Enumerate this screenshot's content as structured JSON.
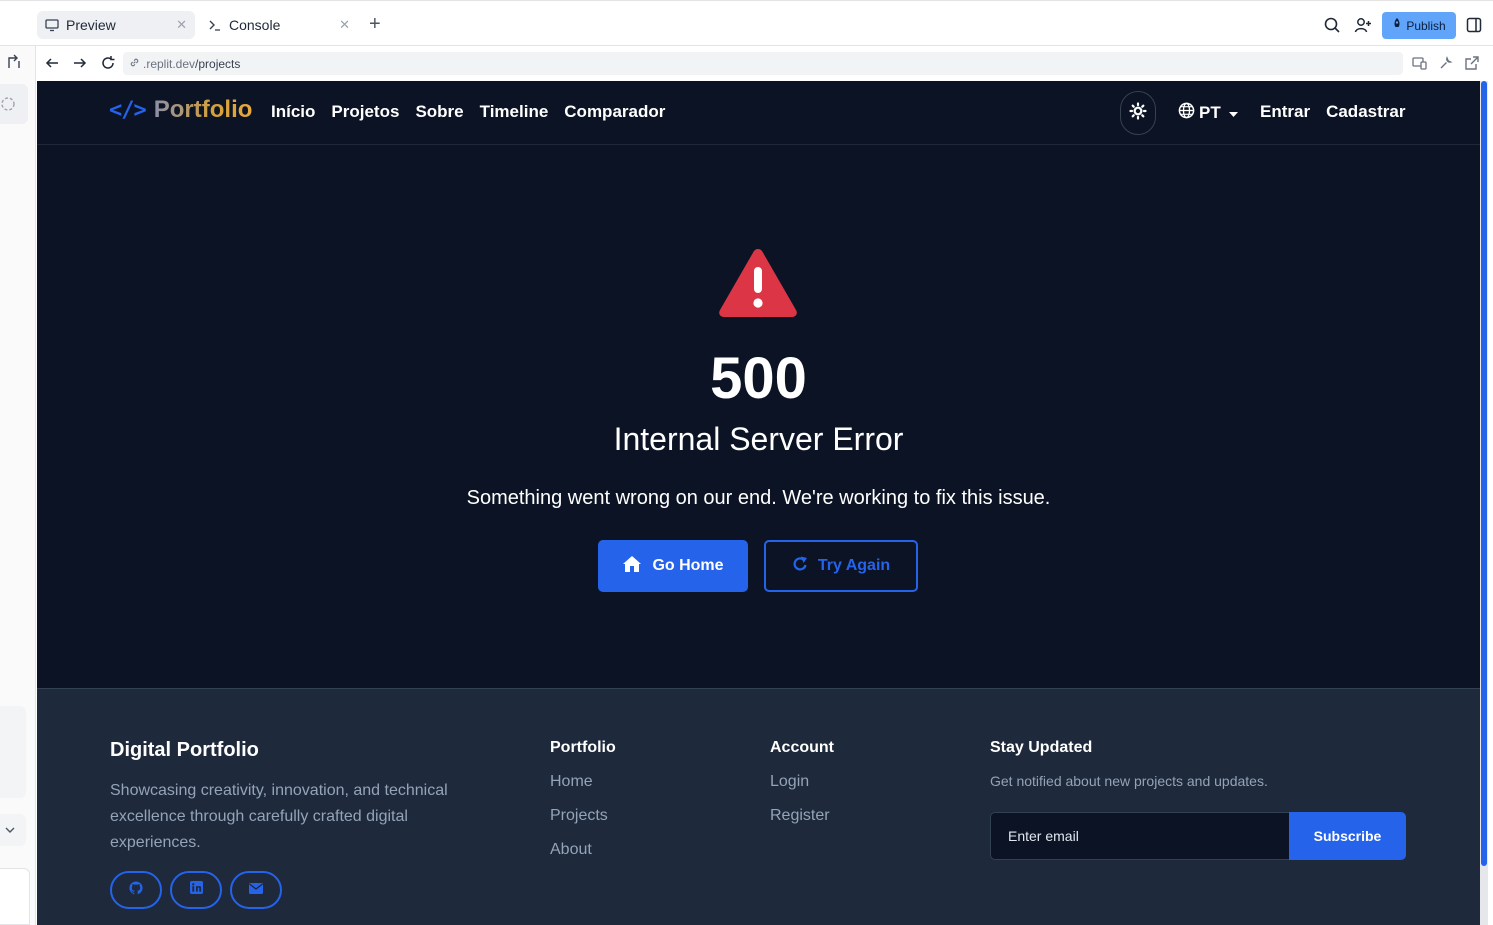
{
  "browser": {
    "tabs": [
      {
        "label": "Preview",
        "icon": "monitor-icon"
      },
      {
        "label": "Console",
        "icon": "terminal-icon"
      }
    ],
    "publish_label": "Publish",
    "url_host": ".replit.dev",
    "url_path": "/projects"
  },
  "nav": {
    "brand_code": "</>",
    "brand": "Portfolio",
    "links": [
      "Início",
      "Projetos",
      "Sobre",
      "Timeline",
      "Comparador"
    ],
    "language": "PT",
    "login": "Entrar",
    "signup": "Cadastrar"
  },
  "error": {
    "code": "500",
    "title": "Internal Server Error",
    "message": "Something went wrong on our end. We're working to fix this issue.",
    "home_label": "Go Home",
    "retry_label": "Try Again"
  },
  "footer": {
    "brand": "Digital Portfolio",
    "description": "Showcasing creativity, innovation, and technical excellence through carefully crafted digital experiences.",
    "portfolio": {
      "heading": "Portfolio",
      "links": [
        "Home",
        "Projects",
        "About"
      ]
    },
    "account": {
      "heading": "Account",
      "links": [
        "Login",
        "Register"
      ]
    },
    "newsletter": {
      "heading": "Stay Updated",
      "text": "Get notified about new projects and updates.",
      "placeholder": "Enter email",
      "button": "Subscribe"
    },
    "socials": [
      "github-icon",
      "linkedin-icon",
      "envelope-icon"
    ]
  },
  "colors": {
    "accent": "#2563eb",
    "page_bg": "#0b1324",
    "footer_bg": "#1e293b",
    "danger": "#dc3545"
  }
}
